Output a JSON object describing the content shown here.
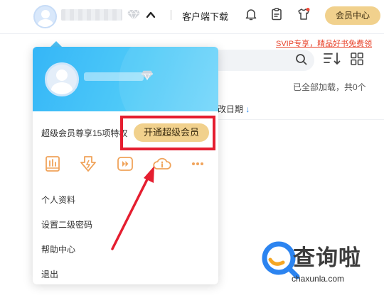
{
  "header": {
    "download_label": "客户端下载",
    "vip_center_label": "会员中心"
  },
  "background": {
    "promo_text": "SVIP专享，精品好书免费领",
    "loaded_status": "已全部加载，共0个",
    "date_column": "改日期"
  },
  "popover": {
    "benefit_text": "超级会员尊享15项特权",
    "open_vip_label": "开通超级会员",
    "features": [
      "report-icon",
      "speed-icon",
      "play-icon",
      "cloud-info-icon",
      "more-icon"
    ],
    "menu": [
      "个人资料",
      "设置二级密码",
      "帮助中心",
      "退出"
    ]
  },
  "watermark": {
    "title": "查询啦",
    "url": "chaxunla.com"
  },
  "colors": {
    "accent_gold": "#f1d18d",
    "header_blue": "#35b6f7",
    "annotation_red": "#e51e30",
    "feature_orange": "#f0a35a"
  }
}
